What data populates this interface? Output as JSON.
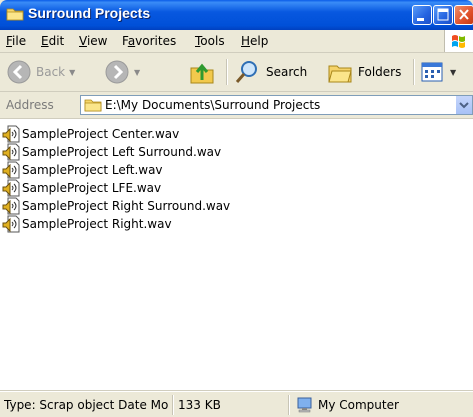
{
  "window": {
    "title": "Surround Projects"
  },
  "menu": [
    "File",
    "Edit",
    "View",
    "Favorites",
    "Tools",
    "Help"
  ],
  "menu_underline": [
    "F",
    "E",
    "V",
    "a",
    "T",
    "H"
  ],
  "toolbar": {
    "back": "Back",
    "search": "Search",
    "folders": "Folders"
  },
  "address": {
    "label": "Address",
    "path": "E:\\My Documents\\Surround Projects"
  },
  "files": [
    "SampleProject Center.wav",
    "SampleProject Left Surround.wav",
    "SampleProject Left.wav",
    "SampleProject LFE.wav",
    "SampleProject Right Surround.wav",
    "SampleProject Right.wav"
  ],
  "status": {
    "type": "Type: Scrap object Date Mo",
    "size": "133 KB",
    "zone": "My Computer"
  },
  "icons": {
    "title": "folder-icon",
    "minimize": "minimize-icon",
    "maximize": "maximize-icon",
    "close": "close-icon",
    "back": "back-arrow-icon",
    "forward": "forward-arrow-icon",
    "up": "up-folder-icon",
    "search": "search-icon",
    "folders": "folders-icon",
    "views": "views-icon",
    "file": "wav-file-icon",
    "computer": "computer-icon"
  }
}
